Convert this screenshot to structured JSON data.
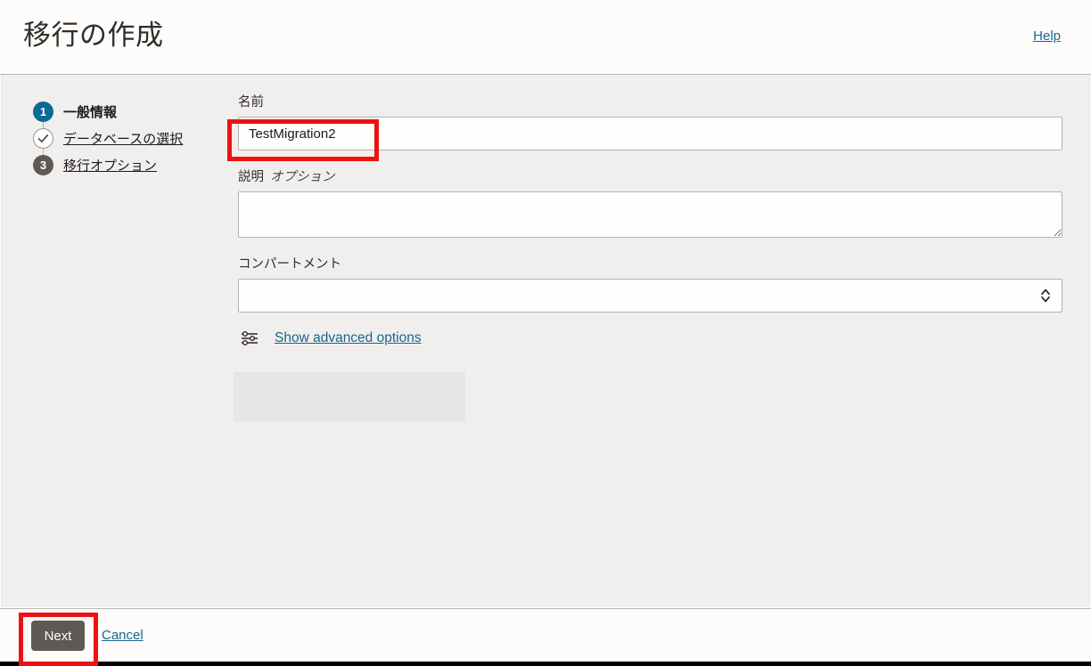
{
  "header": {
    "title": "移行の作成",
    "help_label": "Help"
  },
  "steps": [
    {
      "badge": "1",
      "label": "一般情報",
      "state": "active",
      "name": "step-general-information"
    },
    {
      "badge": "✓",
      "label": "データベースの選択",
      "state": "done",
      "name": "step-select-database"
    },
    {
      "badge": "3",
      "label": "移行オプション",
      "state": "pending",
      "name": "step-migration-options"
    }
  ],
  "form": {
    "name": {
      "label": "名前",
      "value": "TestMigration2",
      "placeholder": ""
    },
    "description": {
      "label": "説明",
      "optional_tag": "オプション",
      "value": "",
      "placeholder": ""
    },
    "compartment": {
      "label": "コンパートメント",
      "value": "",
      "placeholder": ""
    },
    "advanced": {
      "link_label": "Show advanced options",
      "icon": "sliders-icon"
    }
  },
  "footer": {
    "next_label": "Next",
    "cancel_label": "Cancel"
  },
  "colors": {
    "accent_link": "#17688f",
    "step_active": "#0b6a93",
    "step_pending": "#5f5853",
    "button_primary": "#5f5853",
    "highlight": "#ee1111",
    "page_background": "#f1efee",
    "chrome_background": "#fdfcfa"
  },
  "annotations": [
    {
      "name": "highlight-name-field",
      "target": "name-input"
    },
    {
      "name": "highlight-next-button",
      "target": "next-button"
    }
  ]
}
